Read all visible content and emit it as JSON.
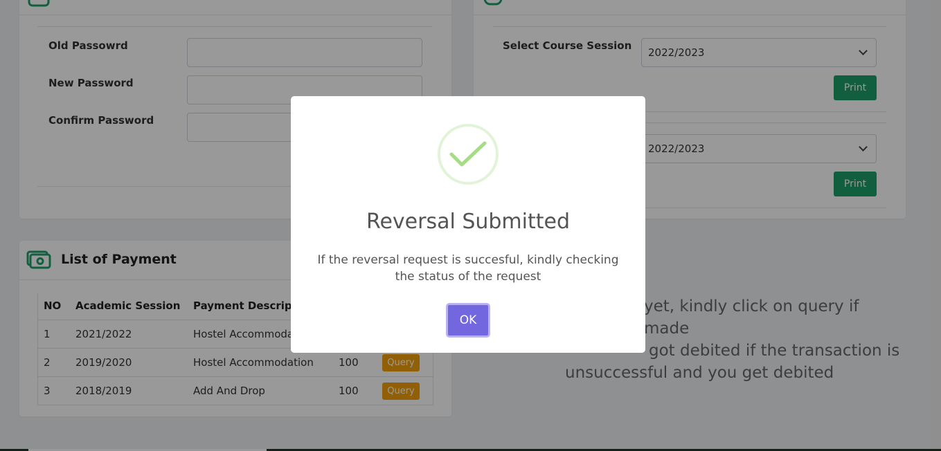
{
  "password_card": {
    "fields": [
      {
        "label": "Old Passowrd",
        "value": ""
      },
      {
        "label": "New Password",
        "value": ""
      },
      {
        "label": "Confirm Password",
        "value": ""
      }
    ]
  },
  "course_card": {
    "select_label": "Select Course Session",
    "select_value_1": "2022/2023",
    "select_value_2": "2022/2023",
    "print_label": "Print"
  },
  "payment_card": {
    "title": "List of Payment",
    "headers": [
      "NO",
      "Academic Session",
      "Payment Descriptio"
    ],
    "rows": [
      {
        "no": "1",
        "session": "2021/2022",
        "description": "Hostel Accommoda",
        "amount": "",
        "action": ""
      },
      {
        "no": "2",
        "session": "2019/2020",
        "description": "Hostel Accommodation",
        "amount": "100",
        "action": "Query"
      },
      {
        "no": "3",
        "session": "2018/2019",
        "description": "Add And Drop",
        "amount": "100",
        "action": "Query"
      }
    ]
  },
  "notice": {
    "line1": "yet, kindly click on query if made",
    "line2": "got debited if the transaction is",
    "line3": "unsuccessful and you get debited"
  },
  "modal": {
    "title": "Reversal Submitted",
    "message": "If the reversal request is succesful, kindly checking the status of the request",
    "ok_label": "OK"
  },
  "colors": {
    "accent_green": "#1e9e69",
    "query_orange": "#f2a10a",
    "ok_purple": "#7367e0",
    "success_green": "#a5dc86"
  },
  "icons": [
    "password-card-icon",
    "course-card-icon",
    "payment-money-icon",
    "hamburger-menu-icon",
    "chevron-down-icon",
    "success-check-icon"
  ]
}
